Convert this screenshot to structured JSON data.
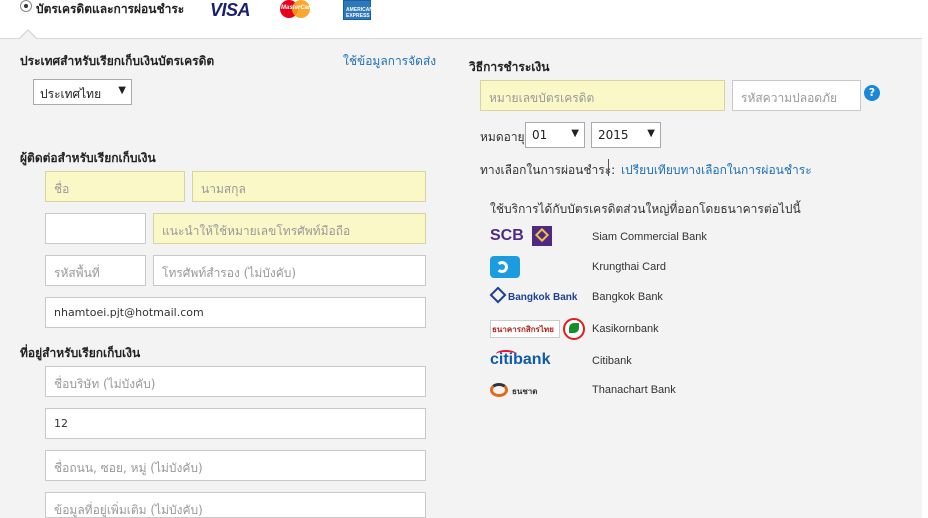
{
  "payment_method": {
    "label": "บัตรเครดิตและการผ่อนชำระ",
    "logos": [
      "VISA",
      "MasterCard",
      "AMERICAN EXPRESS"
    ]
  },
  "billing_country": {
    "heading": "ประเทศสำหรับเรียกเก็บเงินบัตรเครดิต",
    "use_shipping_link": "ใช้ข้อมูลการจัดส่ง",
    "selected": "ประเทศไทย"
  },
  "billing_contact": {
    "heading": "ผู้ติดต่อสำหรับเรียกเก็บเงิน",
    "first_name_placeholder": "ชื่อ",
    "last_name_placeholder": "นามสกุล",
    "mobile_hint": "แนะนำให้ใช้หมายเลขโทรศัพท์มือถือ",
    "area_code_placeholder": "รหัสพื้นที่",
    "backup_phone_placeholder": "โทรศัพท์สำรอง (ไม่บังคับ)",
    "email_value": "nhamtoei.pjt@hotmail.com"
  },
  "billing_address": {
    "heading": "ที่อยู่สำหรับเรียกเก็บเงิน",
    "company_placeholder": "ชื่อบริษัท (ไม่บังคับ)",
    "house_value": "12",
    "street_placeholder": "ชื่อถนน, ซอย, หมู่ (ไม่บังคับ)",
    "extra_placeholder": "ข้อมูลที่อยู่เพิ่มเติม (ไม่บังคับ)"
  },
  "payment": {
    "heading": "วิธีการชำระเงิน",
    "card_number_placeholder": "หมายเลขบัตรเครดิต",
    "security_code_placeholder": "รหัสความปลอดภัย",
    "help_icon": "?",
    "expiry_label": "หมดอายุ",
    "expiry_month": "01",
    "expiry_year": "2015",
    "installment_label": "ทางเลือกในการผ่อนชำระ:",
    "compare_link": "เปรียบเทียบทางเลือกในการผ่อนชำระ",
    "banks_note": "ใช้บริการได้กับบัตรเครดิตส่วนใหญ่ที่ออกโดยธนาคารต่อไปนี้"
  },
  "banks": [
    {
      "name": "Siam Commercial Bank",
      "logo_text": "SCB",
      "color": "#4e2a84"
    },
    {
      "name": "Krungthai Card",
      "logo_text": "",
      "color": "#1b9be0"
    },
    {
      "name": "Bangkok Bank",
      "logo_text": "Bangkok Bank",
      "color": "#1e3f94"
    },
    {
      "name": "Kasikornbank",
      "logo_text": "ธนาคารกสิกรไทย",
      "color": "#138f2d"
    },
    {
      "name": "Citibank",
      "logo_text": "citibank",
      "color": "#0f5ba7"
    },
    {
      "name": "Thanachart Bank",
      "logo_text": "ธนชาต",
      "color": "#e36b1c"
    }
  ],
  "colors": {
    "link": "#1f6fb5",
    "highlight_field": "#fbf8c8",
    "panel_bg": "#f3f3f3"
  }
}
